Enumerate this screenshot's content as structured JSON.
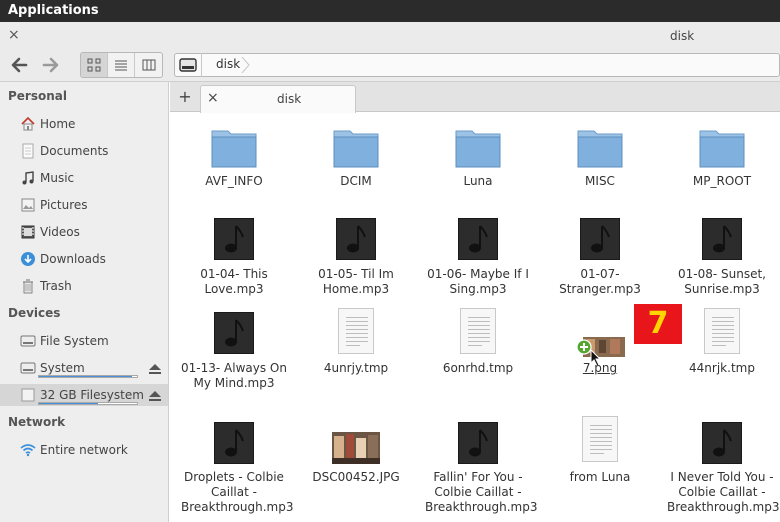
{
  "panel": {
    "title": "Applications"
  },
  "window": {
    "title": "disk",
    "close_glyph": "×"
  },
  "toolbar": {
    "back_icon": "arrow-left-icon",
    "forward_icon": "arrow-right-icon",
    "views": [
      "icon-view",
      "list-view",
      "column-view"
    ],
    "path": "disk"
  },
  "sidebar": {
    "personal_header": "Personal",
    "personal": [
      {
        "label": "Home",
        "icon": "home-icon"
      },
      {
        "label": "Documents",
        "icon": "documents-icon"
      },
      {
        "label": "Music",
        "icon": "music-icon"
      },
      {
        "label": "Pictures",
        "icon": "pictures-icon"
      },
      {
        "label": "Videos",
        "icon": "videos-icon"
      },
      {
        "label": "Downloads",
        "icon": "downloads-icon"
      },
      {
        "label": "Trash",
        "icon": "trash-icon"
      }
    ],
    "devices_header": "Devices",
    "devices": [
      {
        "label": "File System",
        "icon": "harddisk-icon"
      },
      {
        "label": "System",
        "icon": "harddisk-icon",
        "usage": 0.95
      },
      {
        "label": "32 GB Filesystem",
        "icon": "usb-drive-icon",
        "usage": 0.6
      }
    ],
    "network_header": "Network",
    "network": [
      {
        "label": "Entire network",
        "icon": "wifi-icon"
      }
    ]
  },
  "tabs": {
    "add_label": "+",
    "close_glyph": "×",
    "current": "disk"
  },
  "files": [
    {
      "name": "AVF_INFO",
      "type": "folder"
    },
    {
      "name": "DCIM",
      "type": "folder"
    },
    {
      "name": "Luna",
      "type": "folder"
    },
    {
      "name": "MISC",
      "type": "folder"
    },
    {
      "name": "MP_ROOT",
      "type": "folder"
    },
    {
      "name": "01-04- This Love.mp3",
      "type": "music"
    },
    {
      "name": "01-05- Til Im Home.mp3",
      "type": "music"
    },
    {
      "name": "01-06- Maybe If I Sing.mp3",
      "type": "music"
    },
    {
      "name": "01-07- Stranger.mp3",
      "type": "music"
    },
    {
      "name": "01-08- Sunset, Sunrise.mp3",
      "type": "music"
    },
    {
      "name": "01-13- Always On My Mind.mp3",
      "type": "music"
    },
    {
      "name": "4unrjy.tmp",
      "type": "document"
    },
    {
      "name": "6onrhd.tmp",
      "type": "document"
    },
    {
      "name": "7.png",
      "type": "image-dragging"
    },
    {
      "name": "44nrjk.tmp",
      "type": "document"
    },
    {
      "name": "Droplets - Colbie Caillat - Breakthrough.mp3",
      "type": "music"
    },
    {
      "name": "DSC00452.JPG",
      "type": "photo"
    },
    {
      "name": "Fallin' For You - Colbie Caillat - Breakthrough.mp3",
      "type": "music"
    },
    {
      "name": "from Luna",
      "type": "document"
    },
    {
      "name": "I Never Told You - Colbie Caillat - Breakthrough.mp3",
      "type": "music"
    }
  ],
  "overlay_badge": "7",
  "colors": {
    "folder_top": "#b8d4ec",
    "folder_body": "#7fb0de",
    "badge_bg": "#e8161b",
    "badge_fg": "#ffd400",
    "usage_fill": "#4a90d9"
  }
}
